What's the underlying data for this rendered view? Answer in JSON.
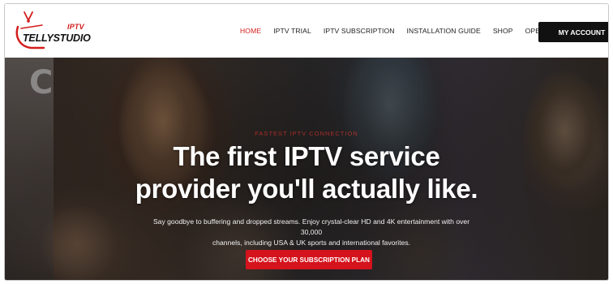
{
  "brand": {
    "tag": "IPTV",
    "name": "TELLYSTUDIO",
    "accent_color": "#d41c1c",
    "logo_icon": "tv-antenna-icon"
  },
  "nav": {
    "items": [
      {
        "label": "HOME",
        "active": true
      },
      {
        "label": "IPTV TRIAL",
        "active": false
      },
      {
        "label": "IPTV SUBSCRIPTION",
        "active": false
      },
      {
        "label": "INSTALLATION GUIDE",
        "active": false
      },
      {
        "label": "SHOP",
        "active": false
      },
      {
        "label": "OPEN DISPUTE",
        "active": false
      }
    ],
    "account_button": "MY ACCOUNT"
  },
  "hero": {
    "eyebrow": "FASTEST IPTV CONNECTION",
    "headline_line1": "The first IPTV service",
    "headline_line2": "provider you'll actually like.",
    "subtext_line1": "Say goodbye to buffering and dropped streams. Enjoy crystal-clear HD and 4K entertainment with over 30,000",
    "subtext_line2": "channels, including USA & UK sports and international favorites.",
    "cta_label": "CHOOSE YOUR SUBSCRIPTION PLAN",
    "cta_color": "#d4131c"
  }
}
